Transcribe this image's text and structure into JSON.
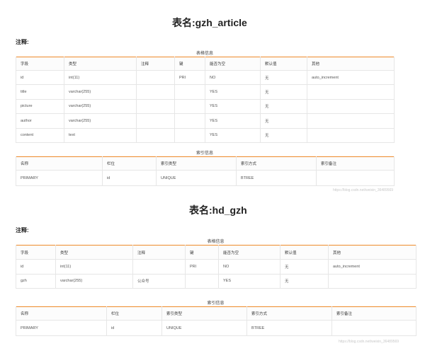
{
  "tables": [
    {
      "title": "表名:gzh_article",
      "comment": "注释:",
      "columns_caption": "表格信息",
      "columns_headers": [
        "字段",
        "类型",
        "注释",
        "键",
        "能否为空",
        "默认值",
        "其他"
      ],
      "columns_rows": [
        [
          "id",
          "int(11)",
          "",
          "PRI",
          "NO",
          "无",
          "auto_increment"
        ],
        [
          "title",
          "varchar(255)",
          "",
          "",
          "YES",
          "无",
          ""
        ],
        [
          "picture",
          "varchar(255)",
          "",
          "",
          "YES",
          "无",
          ""
        ],
        [
          "author",
          "varchar(255)",
          "",
          "",
          "YES",
          "无",
          ""
        ],
        [
          "content",
          "text",
          "",
          "",
          "YES",
          "无",
          ""
        ]
      ],
      "index_caption": "索引信息",
      "index_headers": [
        "名称",
        "栏位",
        "索引类型",
        "索引方式",
        "索引备注"
      ],
      "index_rows": [
        [
          "PRIMARY",
          "id",
          "UNIQUE",
          "BTREE",
          ""
        ]
      ]
    },
    {
      "title": "表名:hd_gzh",
      "comment": "注释:",
      "columns_caption": "表格信息",
      "columns_headers": [
        "字段",
        "类型",
        "注释",
        "键",
        "能否为空",
        "默认值",
        "其他"
      ],
      "columns_rows": [
        [
          "id",
          "int(11)",
          "",
          "PRI",
          "NO",
          "无",
          "auto_increment"
        ],
        [
          "gzh",
          "varchar(255)",
          "公众号",
          "",
          "YES",
          "无",
          ""
        ]
      ],
      "index_caption": "索引信息",
      "index_headers": [
        "名称",
        "栏位",
        "索引类型",
        "索引方式",
        "索引备注"
      ],
      "index_rows": [
        [
          "PRIMARY",
          "id",
          "UNIQUE",
          "BTREE",
          ""
        ]
      ]
    }
  ],
  "watermarks": [
    "https://blog.csdn.net/weixin_36489569",
    "https://blog.csdn.net/weixin_36489569"
  ]
}
